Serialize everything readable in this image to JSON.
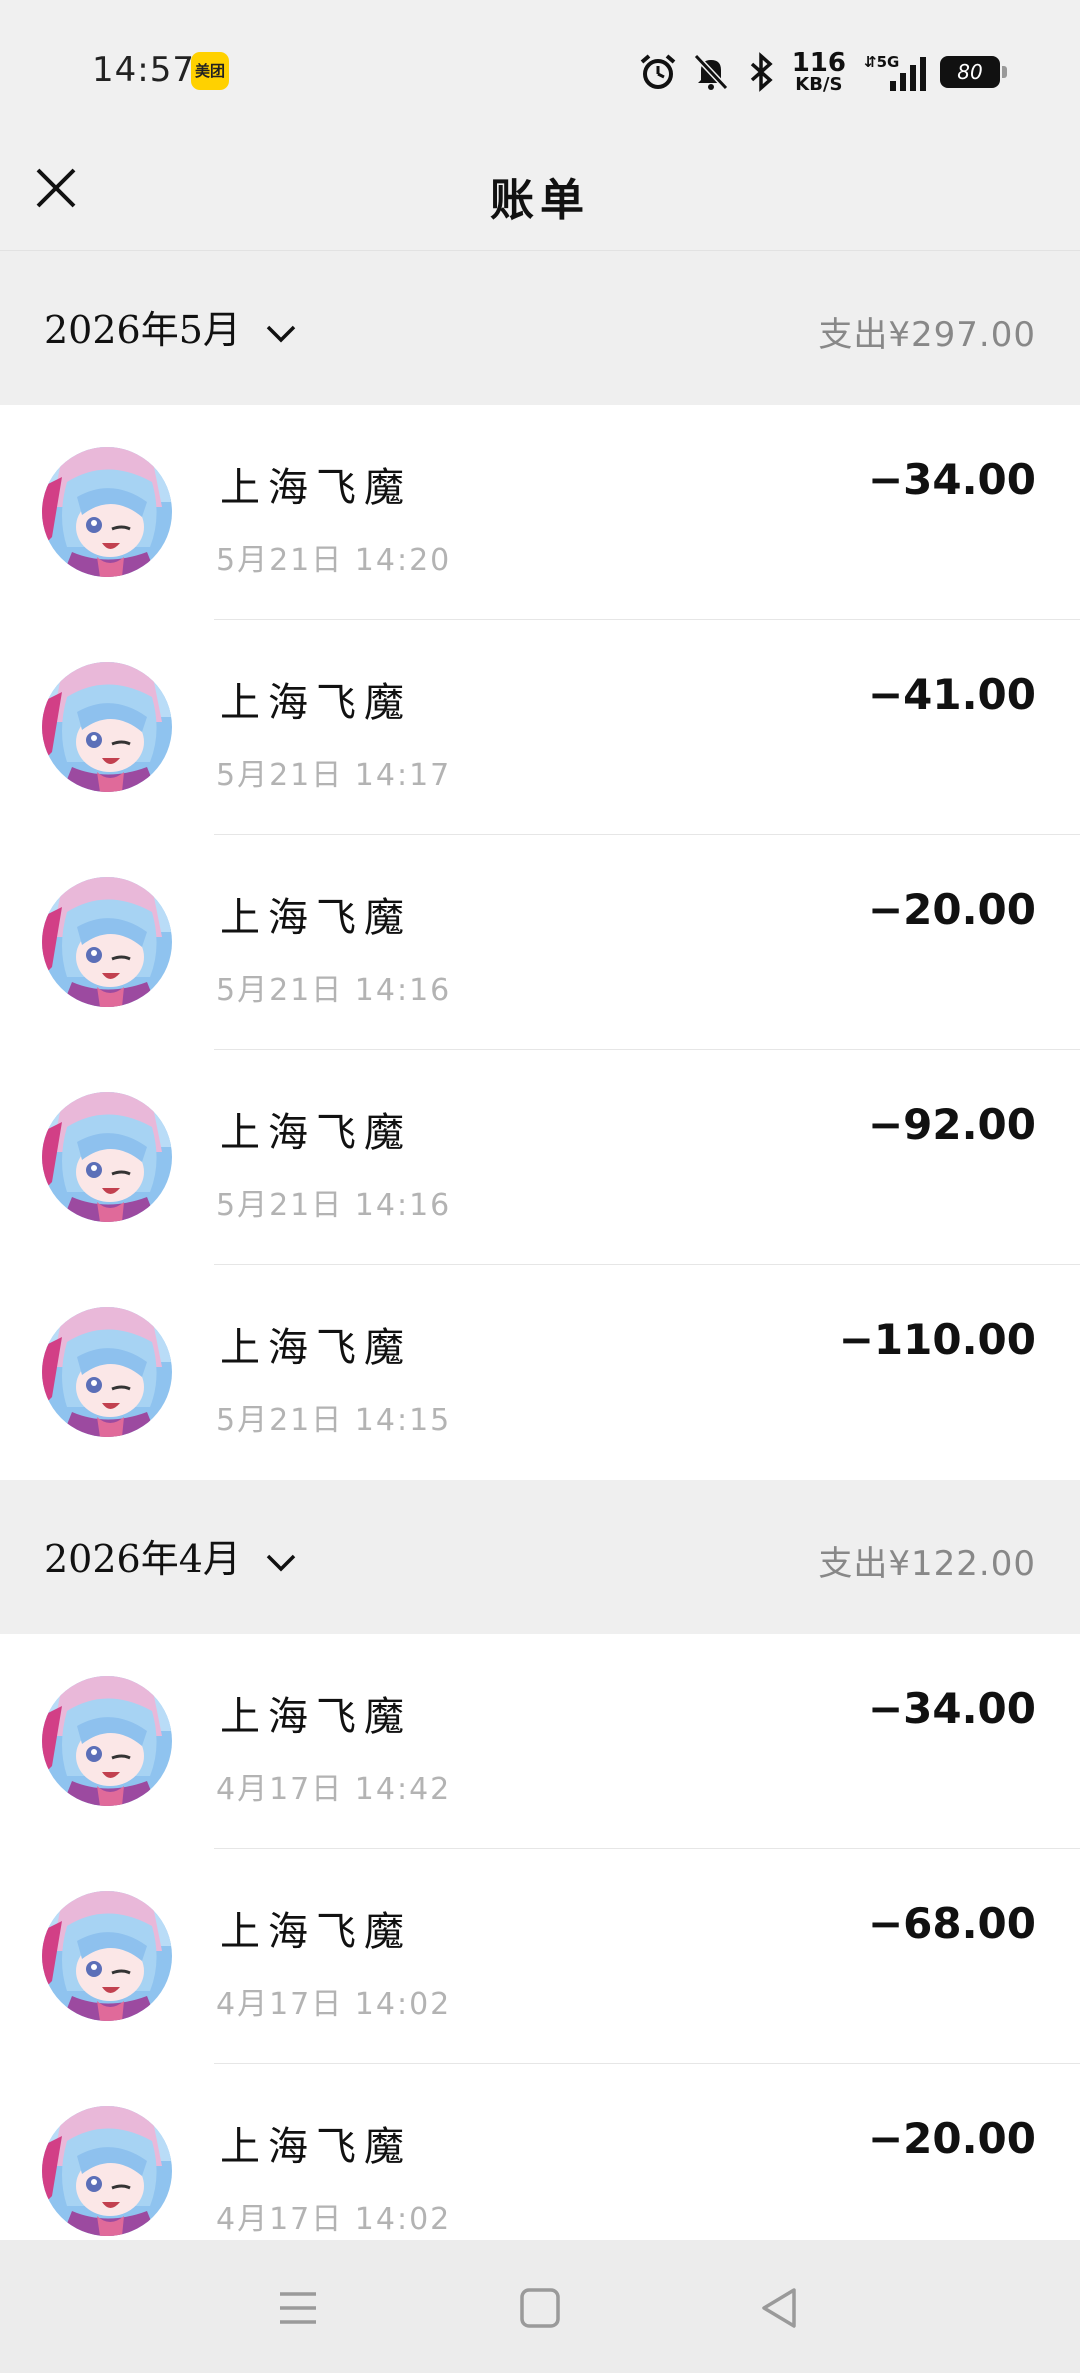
{
  "status": {
    "time": "14:57",
    "app_badge": "美团",
    "net_speed_value": "116",
    "net_speed_unit": "KB/S",
    "network": "5G",
    "battery": "80"
  },
  "header": {
    "title": "账单"
  },
  "months": [
    {
      "label": "2026年5月",
      "total": "支出¥297.00",
      "items": [
        {
          "title": "上海飞魔",
          "time": "5月21日 14:20",
          "amount": "−34.00"
        },
        {
          "title": "上海飞魔",
          "time": "5月21日 14:17",
          "amount": "−41.00"
        },
        {
          "title": "上海飞魔",
          "time": "5月21日 14:16",
          "amount": "−20.00"
        },
        {
          "title": "上海飞魔",
          "time": "5月21日 14:16",
          "amount": "−92.00"
        },
        {
          "title": "上海飞魔",
          "time": "5月21日 14:15",
          "amount": "−110.00"
        }
      ]
    },
    {
      "label": "2026年4月",
      "total": "支出¥122.00",
      "items": [
        {
          "title": "上海飞魔",
          "time": "4月17日 14:42",
          "amount": "−34.00"
        },
        {
          "title": "上海飞魔",
          "time": "4月17日 14:02",
          "amount": "−68.00"
        },
        {
          "title": "上海飞魔",
          "time": "4月17日 14:02",
          "amount": "−20.00"
        }
      ]
    }
  ],
  "colors": {
    "background": "#f0f0f0",
    "list_bg": "#ffffff",
    "secondary_text": "#b3b3b3",
    "total_text": "#888888"
  },
  "icons": {
    "close": "close-icon",
    "chevron": "chevron-down-icon",
    "menu": "menu-icon",
    "home": "home-square-icon",
    "back": "back-triangle-icon"
  }
}
